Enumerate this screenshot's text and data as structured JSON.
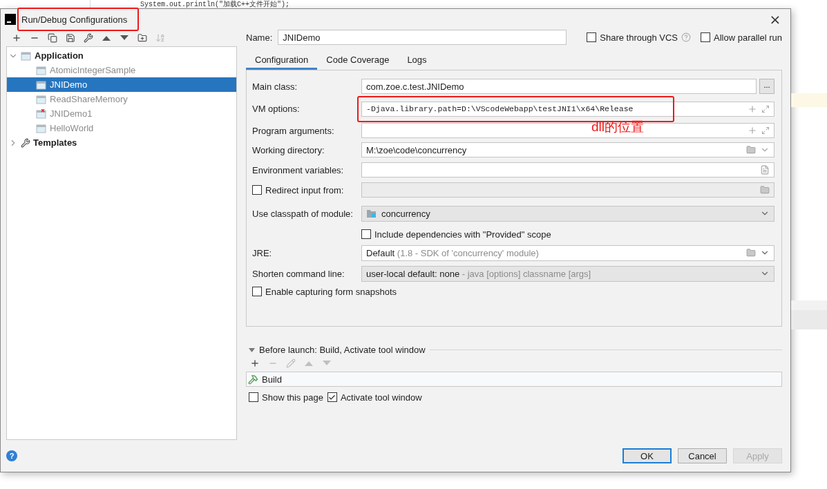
{
  "editor": {
    "code_line": "System.out.println(\"加载C++文件开始\");"
  },
  "window": {
    "title": "Run/Debug Configurations",
    "highlighted": true,
    "close": "×"
  },
  "toolbar": [
    {
      "kind": "add",
      "disabled": false
    },
    {
      "kind": "remove",
      "disabled": false
    },
    {
      "kind": "copy",
      "disabled": false
    },
    {
      "kind": "save",
      "disabled": false
    },
    {
      "kind": "wrench",
      "disabled": false
    },
    {
      "kind": "up",
      "disabled": false
    },
    {
      "kind": "down",
      "disabled": false
    },
    {
      "kind": "folder",
      "disabled": false
    },
    {
      "kind": "sort",
      "disabled": true
    }
  ],
  "tree": [
    {
      "label": "Application",
      "expanded": true,
      "selected": false,
      "kind": "group",
      "children": [
        {
          "label": "AtomicIntegerSample",
          "selected": false,
          "error": false,
          "temporary": true
        },
        {
          "label": "JNIDemo",
          "selected": true,
          "error": false,
          "temporary": false
        },
        {
          "label": "ReadShareMemory",
          "selected": false,
          "error": false,
          "temporary": true
        },
        {
          "label": "JNIDemo1",
          "selected": false,
          "error": true,
          "temporary": true
        },
        {
          "label": "HelloWorld",
          "selected": false,
          "error": false,
          "temporary": true
        }
      ]
    },
    {
      "label": "Templates",
      "expanded": false,
      "selected": false,
      "kind": "templates"
    }
  ],
  "name": {
    "label": "Name:",
    "value": "JNIDemo"
  },
  "options": [
    {
      "label": "Share through VCS",
      "checked": false,
      "help": true
    },
    {
      "label": "Allow parallel run",
      "checked": false,
      "help": false
    }
  ],
  "tabs": [
    {
      "label": "Configuration",
      "selected": true
    },
    {
      "label": "Code Coverage",
      "selected": false
    },
    {
      "label": "Logs",
      "selected": false
    }
  ],
  "fields": [
    {
      "kind": "browse",
      "label": "Main class:",
      "value": "com.zoe.c.test.JNIDemo",
      "button": "..."
    },
    {
      "kind": "expandable",
      "label": "VM options:",
      "value": "-Djava.library.path=D:\\VScodeWebapp\\testJNI1\\x64\\Release",
      "highlighted": true,
      "annotation": "dll的位置"
    },
    {
      "kind": "expandable",
      "label": "Program arguments:",
      "highlighted": false
    },
    {
      "kind": "directory",
      "label": "Working directory:",
      "value": "M:\\zoe\\code\\concurrency"
    },
    {
      "kind": "env",
      "label": "Environment variables:"
    },
    {
      "kind": "redirect",
      "label": "Redirect input from:",
      "checked": false
    },
    {
      "kind": "module",
      "label": "Use classpath of module:",
      "value": "concurrency"
    },
    {
      "kind": "checkbox",
      "label": "Include dependencies with \"Provided\" scope",
      "checked": false
    },
    {
      "kind": "jre",
      "label": "JRE:",
      "value": "Default",
      "hint": "(1.8 - SDK of 'concurrency' module)"
    },
    {
      "kind": "shorten",
      "label": "Shorten command line:",
      "value": "user-local default: none",
      "hint": "- java [options] classname [args]"
    },
    {
      "kind": "checkbox_left",
      "label": "Enable capturing form snapshots",
      "checked": false
    }
  ],
  "before_launch": {
    "title": "Before launch: Build, Activate tool window",
    "expanded": true,
    "toolbar": [
      {
        "kind": "add",
        "disabled": false
      },
      {
        "kind": "remove",
        "disabled": true
      },
      {
        "kind": "edit",
        "disabled": true
      },
      {
        "kind": "up",
        "disabled": true
      },
      {
        "kind": "down",
        "disabled": true
      }
    ],
    "tasks": [
      {
        "label": "Build"
      }
    ],
    "checks": [
      {
        "label": "Show this page",
        "checked": false
      },
      {
        "label": "Activate tool window",
        "checked": true
      }
    ]
  },
  "footer": {
    "help": "?"
  },
  "buttons": [
    {
      "label": "OK",
      "default": true,
      "disabled": false
    },
    {
      "label": "Cancel",
      "default": false,
      "disabled": false
    },
    {
      "label": "Apply",
      "default": false,
      "disabled": true
    }
  ]
}
